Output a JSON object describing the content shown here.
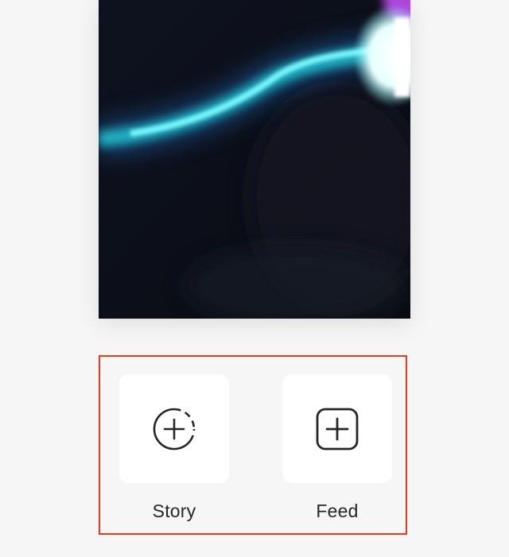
{
  "preview": {
    "colors": {
      "background": "#0d1018",
      "glow_cyan": "#2ff0f0",
      "glow_white": "#ffffff",
      "glow_magenta": "#c24cf0",
      "glow_blue": "#1e6fb0"
    }
  },
  "share_options": [
    {
      "label": "Story",
      "icon": "story-add-icon"
    },
    {
      "label": "Feed",
      "icon": "feed-add-icon"
    }
  ],
  "colors": {
    "page_background": "#f6f6f6",
    "tile_background": "#ffffff",
    "icon_stroke": "#262626",
    "highlight_border": "#e8391d"
  }
}
